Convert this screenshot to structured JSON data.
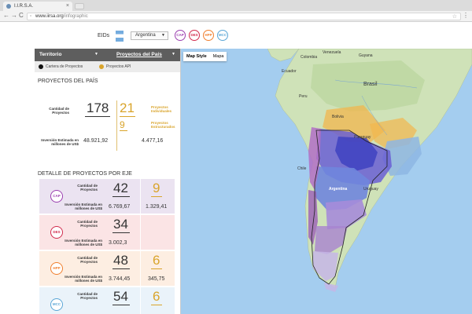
{
  "browser": {
    "tab_title": "I.I.R.S.A.",
    "url_domain": "www.iirsa.org",
    "url_path": "/infographic",
    "back": "←",
    "forward": "→",
    "reload": "C",
    "menu": "⋮"
  },
  "header": {
    "eids_label": "EIDs",
    "country": "Argentina",
    "ejes": [
      {
        "code": "CAP",
        "color": "#9b3fb0"
      },
      {
        "code": "DES",
        "color": "#d12b4c"
      },
      {
        "code": "HPP",
        "color": "#f07f2e"
      },
      {
        "code": "MCC",
        "color": "#5aa6d6"
      }
    ]
  },
  "sidebar": {
    "tab_territorio": "Territorio",
    "tab_proyectos": "Proyectos del País",
    "legend_cartera": "Cartera de Proyectos",
    "legend_api": "Proyectos API",
    "legend_colors": {
      "cartera": "#111111",
      "api": "#d9a42b"
    },
    "country_title": "PROYECTOS DEL PAÍS",
    "cantidad_label": "Cantidad de Proyectos",
    "inversion_label": "Inversión Estimada en millones de US$",
    "total_projects": "178",
    "total_investment": "48.921,92",
    "api_individual_count": "21",
    "api_individual_label": "Proyectos Individuales",
    "api_structured_count": "9",
    "api_structured_label": "Proyectos Estructurados",
    "api_investment": "4.477,16",
    "axis_title": "DETALLE DE PROYECTOS POR EJE",
    "axes": [
      {
        "code": "CAP",
        "projects": "42",
        "investment": "6.769,67",
        "api_projects": "9",
        "api_investment": "1.329,41",
        "bg": "#ebe3f1",
        "color": "#9b3fb0"
      },
      {
        "code": "DES",
        "projects": "34",
        "investment": "3.002,3",
        "api_projects": "",
        "api_investment": "",
        "bg": "#fbe4e5",
        "color": "#d12b4c"
      },
      {
        "code": "HPP",
        "projects": "48",
        "investment": "3.744,45",
        "api_projects": "6",
        "api_investment": "345,75",
        "bg": "#fdeee2",
        "color": "#f07f2e"
      },
      {
        "code": "MCC",
        "projects": "54",
        "investment": "",
        "api_projects": "6",
        "api_investment": "",
        "bg": "#eaf3fa",
        "color": "#5aa6d6"
      }
    ]
  },
  "map": {
    "type_satellite": "Map Style",
    "type_map": "Mapa",
    "labels": {
      "brasil": "Brasil",
      "peru": "Peru",
      "bolivia": "Bolivia",
      "argentina": "Argentina",
      "chile": "Chile",
      "paraguay": "Paraguay",
      "uruguay": "Uruguay",
      "colombia": "Colombia",
      "venezuela": "Venezuela",
      "ecuador": "Ecuador",
      "guyana": "Guyana"
    }
  }
}
